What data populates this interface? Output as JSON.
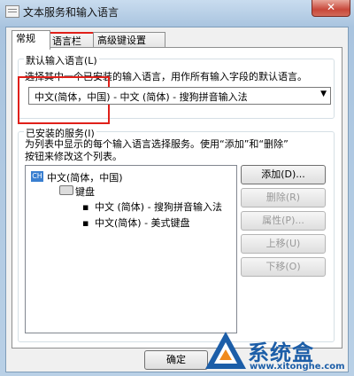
{
  "window": {
    "title": "文本服务和输入语言",
    "close_label": "✕"
  },
  "tabs": [
    "常规",
    "语言栏",
    "高级键设置"
  ],
  "default_language": {
    "group_title": "默认输入语言(L)",
    "description": "选择其中一个已安装的输入语言，用作所有输入字段的默认语言。",
    "selected": "中文(简体，中国) - 中文 (简体) - 搜狗拼音输入法"
  },
  "installed_services": {
    "group_title": "已安装的服务(I)",
    "description_line1": "为列表中显示的每个输入语言选择服务。使用“添加”和“删除”",
    "description_line2": "按钮来修改这个列表。",
    "language_code": "CH",
    "language": "中文(简体，中国)",
    "category": "键盘",
    "services": [
      "中文 (简体) - 搜狗拼音输入法",
      "中文(简体) - 美式键盘"
    ]
  },
  "buttons": {
    "add": "添加(D)...",
    "remove": "删除(R)",
    "properties": "属性(P)...",
    "move_up": "上移(U)",
    "move_down": "下移(O)"
  },
  "footer": {
    "ok": "确定"
  },
  "watermark": {
    "site": "系统盒",
    "url": "www.xitonghe.com"
  }
}
